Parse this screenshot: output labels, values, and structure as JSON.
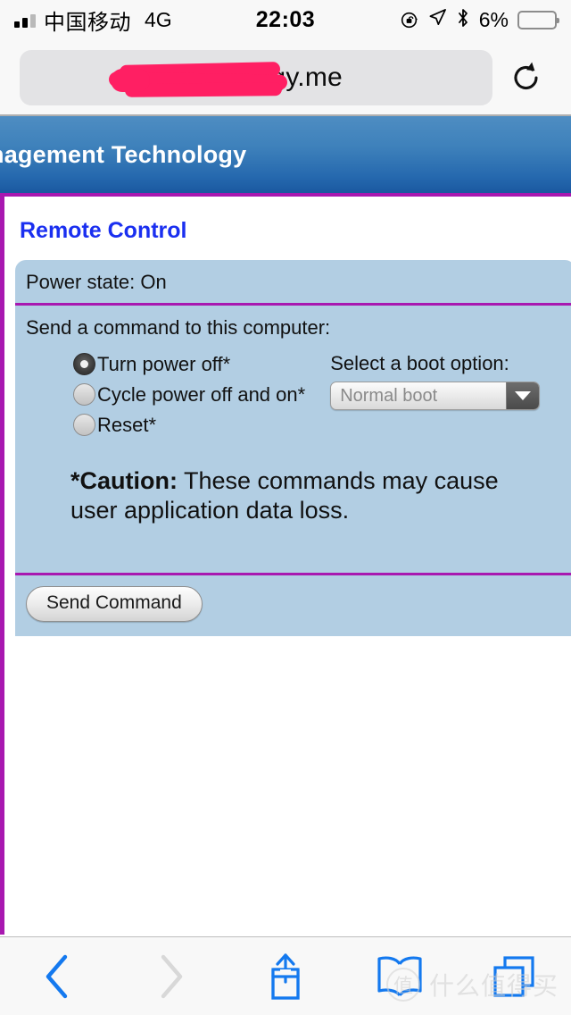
{
  "status_bar": {
    "carrier": "中国移动",
    "network_type": "4G",
    "time": "22:03",
    "battery_percent": "6%",
    "battery_level": 6,
    "icons": [
      "signal-bars-icon",
      "rotation-lock-icon",
      "location-arrow-icon",
      "bluetooth-icon",
      "battery-icon"
    ]
  },
  "browser": {
    "url_text": "e.synology.me",
    "url_redacted": true,
    "reload_label": "reload-icon"
  },
  "page": {
    "banner_title": "nagement Technology",
    "section_title": "Remote Control",
    "power_state": "Power state: On",
    "command_lead": "Send a command to this computer:",
    "commands": [
      {
        "label": "Turn power off*",
        "selected": true
      },
      {
        "label": "Cycle power off and on*",
        "selected": false
      },
      {
        "label": "Reset*",
        "selected": false
      }
    ],
    "boot": {
      "label": "Select a boot option:",
      "selected_value": "Normal boot",
      "options": [
        "Normal boot"
      ]
    },
    "caution": {
      "prefix": "*Caution:",
      "text": " These commands may cause user application data loss."
    },
    "send_button": "Send Command"
  },
  "toolbar": {
    "back": "back-chevron-icon",
    "forward": "forward-chevron-icon",
    "share": "share-icon",
    "bookmarks": "bookmarks-icon",
    "tabs": "tabs-icon"
  },
  "watermark": {
    "logo_char": "值",
    "text": "什么值得买"
  },
  "colors": {
    "banner_top": "#4e8dc2",
    "banner_bottom": "#1a58a0",
    "panel_bg": "#b2cee3",
    "accent_border": "#a818b0",
    "heading_blue": "#1a2ff0",
    "battery_red": "#fb3b2f",
    "toolbar_blue": "#1479ef",
    "redaction_pink": "#ff1f63"
  }
}
